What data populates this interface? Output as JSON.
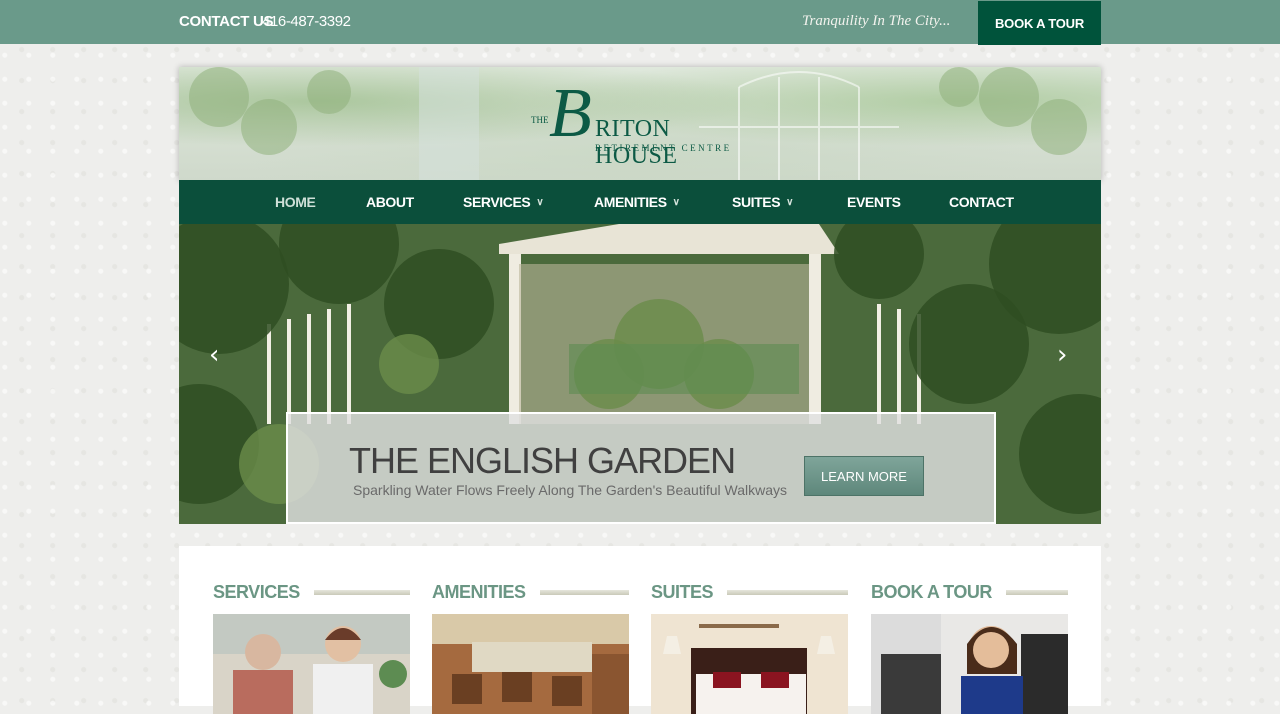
{
  "topbar": {
    "contact_label": "CONTACT US",
    "phone": "416-487-3392",
    "tagline": "Tranquility In The City...",
    "book_button": "BOOK A TOUR"
  },
  "logo": {
    "the": "THE",
    "b": "B",
    "riton_house": "RITON HOUSE",
    "subtitle": "RETIREMENT CENTRE"
  },
  "nav": {
    "items": [
      {
        "label": "HOME",
        "active": true
      },
      {
        "label": "ABOUT"
      },
      {
        "label": "SERVICES",
        "dropdown": true
      },
      {
        "label": "AMENITIES",
        "dropdown": true
      },
      {
        "label": "SUITES",
        "dropdown": true
      },
      {
        "label": "EVENTS"
      },
      {
        "label": "CONTACT"
      }
    ]
  },
  "slider": {
    "title": "THE ENGLISH GARDEN",
    "subtitle": "Sparkling Water Flows Freely Along The Garden's Beautiful Walkways",
    "button": "LEARN MORE",
    "prev_icon": "chevron-left-icon",
    "next_icon": "chevron-right-icon"
  },
  "sections": [
    {
      "title": "SERVICES"
    },
    {
      "title": "AMENITIES"
    },
    {
      "title": "SUITES"
    },
    {
      "title": "BOOK A TOUR"
    }
  ],
  "colors": {
    "topbar": "#6a9a8a",
    "nav": "#0b4f3b",
    "book_button": "#00533b",
    "section_title": "#6b9684"
  }
}
